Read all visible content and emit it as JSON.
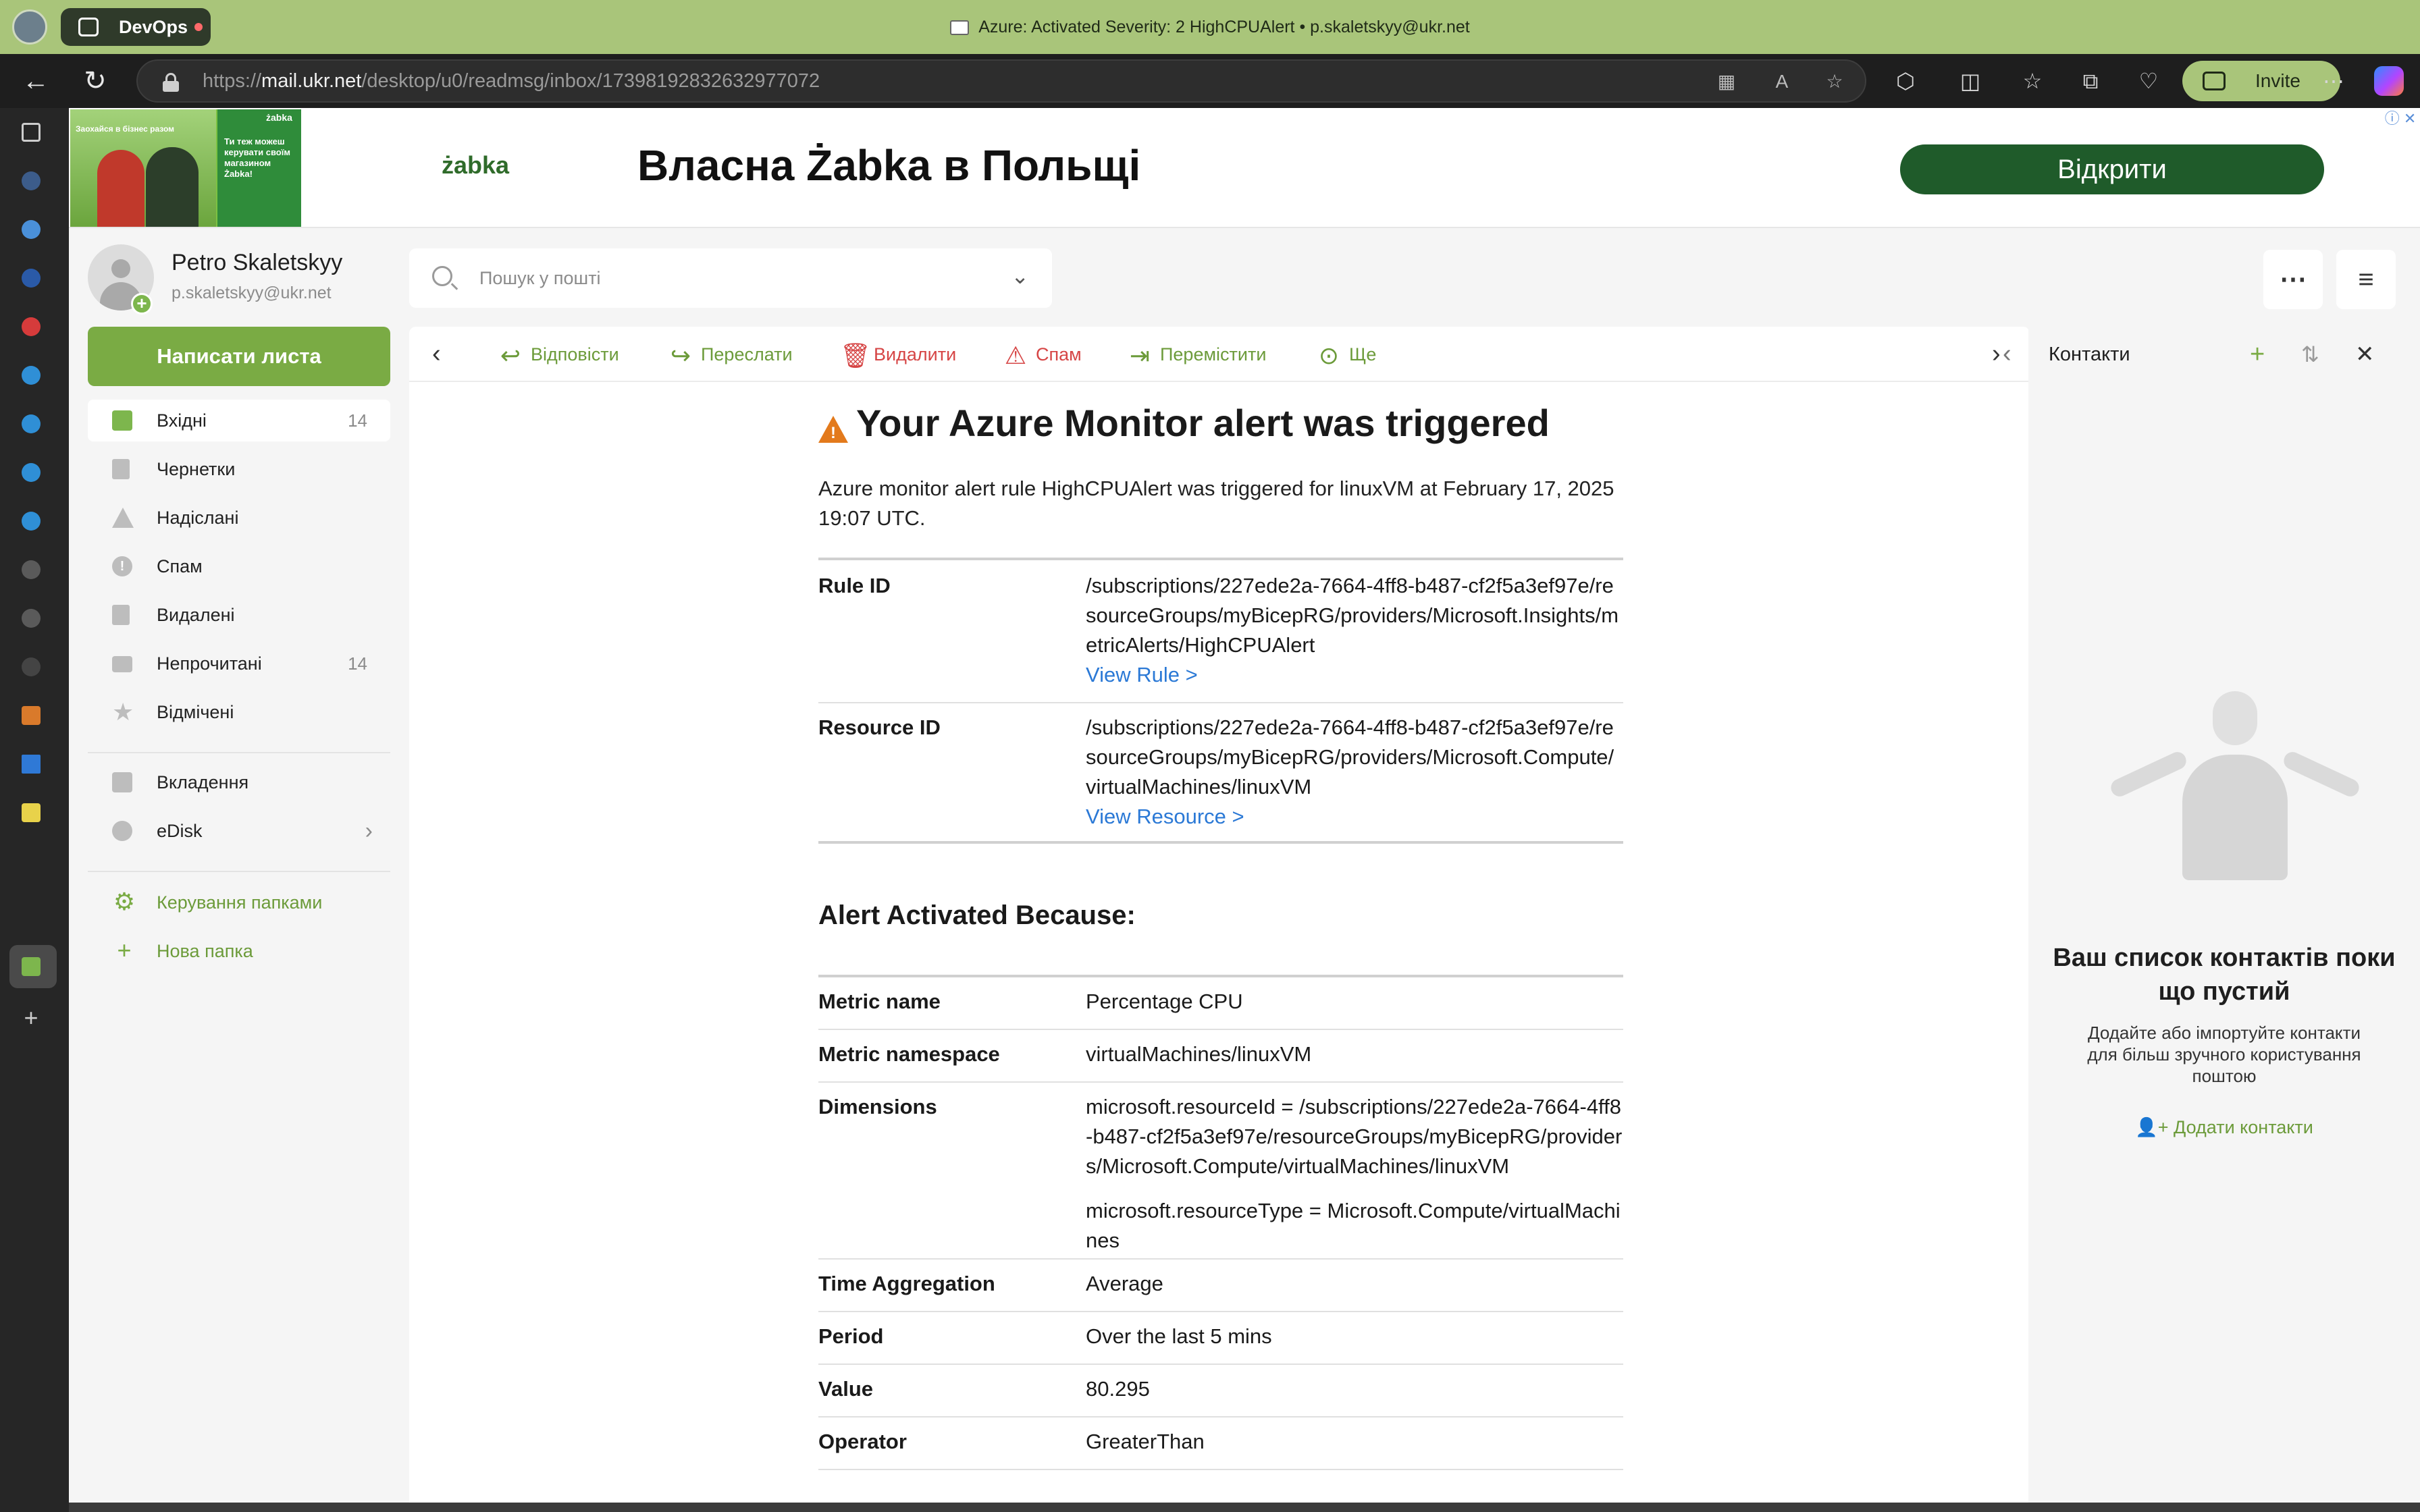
{
  "browser": {
    "tab_group": "DevOps",
    "window_title": "Azure: Activated Severity: 2 HighCPUAlert • p.skaletskyy@ukr.net",
    "url_scheme": "https://",
    "url_host": "mail.ukr.net",
    "url_path": "/desktop/u0/readmsg/inbox/17398192832632977072",
    "invite_label": "Invite"
  },
  "ad": {
    "brand": "żabka",
    "headline": "Власна Żabka в Польщі",
    "cta": "Відкрити",
    "image_tag": "Заохайся в бізнес разом",
    "image_side": "Ти теж можеш керувати своїм магазином Żabka!",
    "image_brand": "żabka",
    "info": "ⓘ ✕"
  },
  "account": {
    "name": "Petro Skaletskyy",
    "email": "p.skaletskyy@ukr.net"
  },
  "compose_label": "Написати листа",
  "folders": [
    {
      "label": "Вхідні",
      "count": "14"
    },
    {
      "label": "Чернетки",
      "count": ""
    },
    {
      "label": "Надіслані",
      "count": ""
    },
    {
      "label": "Спам",
      "count": ""
    },
    {
      "label": "Видалені",
      "count": ""
    },
    {
      "label": "Непрочитані",
      "count": "14"
    },
    {
      "label": "Відмічені",
      "count": ""
    }
  ],
  "extra_folders": [
    {
      "label": "Вкладення"
    },
    {
      "label": "eDisk"
    }
  ],
  "manage": {
    "folders": "Керування папками",
    "new_folder": "Нова папка"
  },
  "search": {
    "placeholder": "Пошук у пошті"
  },
  "actions": {
    "reply": "Відповісти",
    "forward": "Переслати",
    "delete": "Видалити",
    "spam": "Спам",
    "move": "Перемістити",
    "more": "Ще"
  },
  "message": {
    "title": "Your Azure Monitor alert was triggered",
    "intro": "Azure monitor alert rule HighCPUAlert was triggered for linuxVM at February 17, 2025 19:07 UTC.",
    "rule_id_label": "Rule ID",
    "rule_id": "/subscriptions/227ede2a-7664-4ff8-b487-cf2f5a3ef97e/resourceGroups/myBicepRG/providers/Microsoft.Insights/metricAlerts/HighCPUAlert",
    "view_rule": "View Rule >",
    "resource_id_label": "Resource ID",
    "resource_id": "/subscriptions/227ede2a-7664-4ff8-b487-cf2f5a3ef97e/resourceGroups/myBicepRG/providers/Microsoft.Compute/virtualMachines/linuxVM",
    "view_resource": "View Resource >",
    "section": "Alert Activated Because:",
    "details": [
      {
        "key": "Metric name",
        "value": "Percentage CPU"
      },
      {
        "key": "Metric namespace",
        "value": "virtualMachines/linuxVM"
      },
      {
        "key": "Dimensions",
        "value": "microsoft.resourceId = /subscriptions/227ede2a-7664-4ff8-b487-cf2f5a3ef97e/resourceGroups/myBicepRG/providers/Microsoft.Compute/virtualMachines/linuxVM"
      },
      {
        "key": "",
        "value": "microsoft.resourceType = Microsoft.Compute/virtualMachines"
      },
      {
        "key": "Time Aggregation",
        "value": "Average"
      },
      {
        "key": "Period",
        "value": "Over the last 5 mins"
      },
      {
        "key": "Value",
        "value": "80.295"
      },
      {
        "key": "Operator",
        "value": "GreaterThan"
      }
    ]
  },
  "contacts": {
    "title": "Контакти",
    "empty_title": "Ваш список контактів поки що пустий",
    "empty_text": "Додайте або імпортуйте контакти для більш зручного користування поштою",
    "add": "Додати контакти"
  },
  "colors": {
    "titlebar": "#a9c57a",
    "accent_green": "#7aab44",
    "link_blue": "#2b79d6",
    "danger_red": "#d64545",
    "warning_orange": "#e37a1c"
  }
}
